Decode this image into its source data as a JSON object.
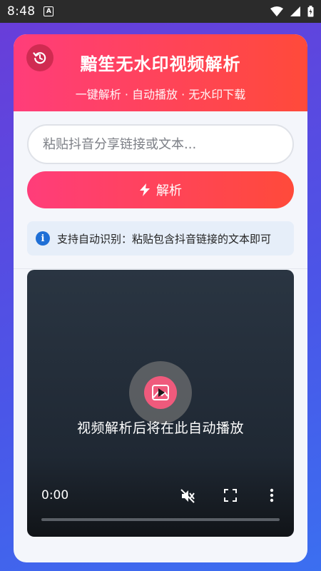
{
  "status_bar": {
    "time": "8:48",
    "app_icon_letter": "A"
  },
  "header": {
    "title": "黯笙无水印视频解析",
    "subtitle": "一键解析 · 自动播放 · 无水印下载"
  },
  "input": {
    "placeholder": "粘贴抖音分享链接或文本...",
    "value": ""
  },
  "parse_button": {
    "label": "解析"
  },
  "hint": {
    "text": "支持自动识别：粘贴包含抖音链接的文本即可"
  },
  "player": {
    "message": "视频解析后将在此自动播放",
    "time": "0:00",
    "progress": 0
  },
  "colors": {
    "accent_start": "#ff3d7a",
    "accent_end": "#ff4a3a",
    "info_blue": "#1f6fd6"
  }
}
